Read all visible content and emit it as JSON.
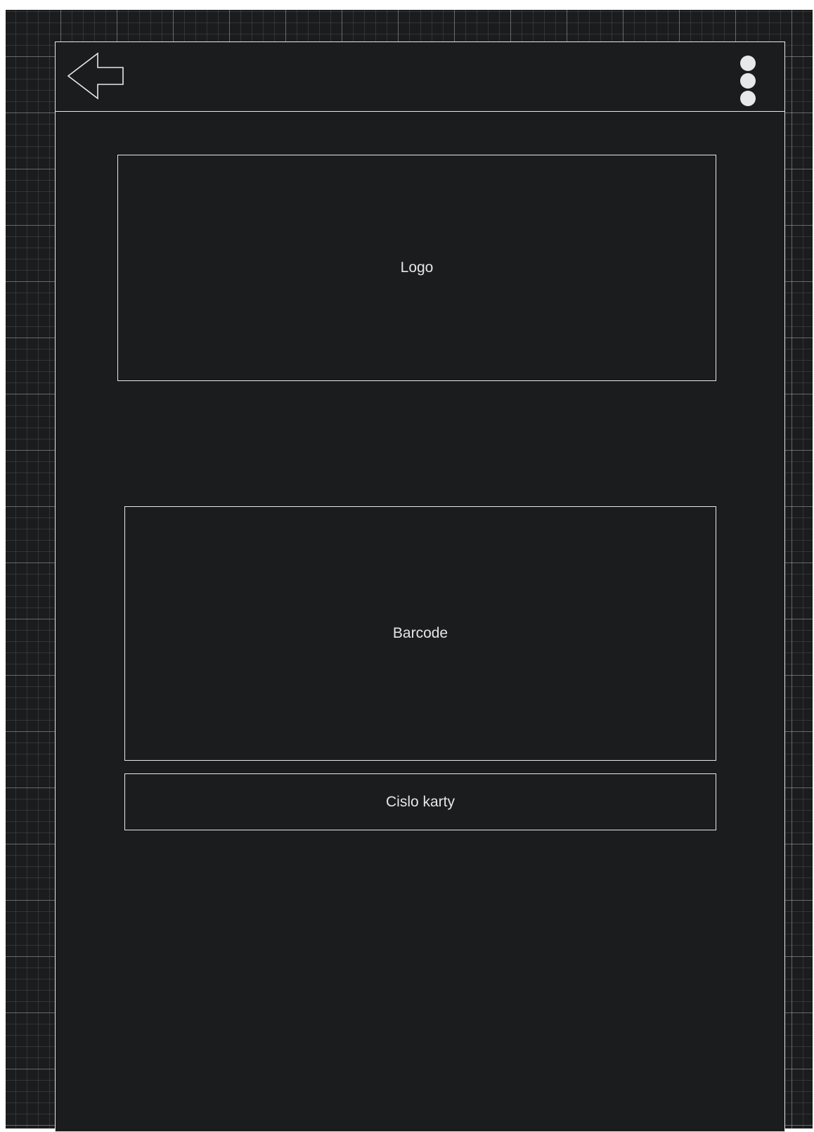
{
  "toolbar": {
    "back_icon": "back-arrow-icon",
    "more_icon": "more-vertical-icon"
  },
  "content": {
    "logo_label": "Logo",
    "barcode_label": "Barcode",
    "card_number_label": "Cislo karty"
  },
  "colors": {
    "canvas_background": "#1b1c1e",
    "stroke": "#e8e8e8",
    "text": "#e6e6e6",
    "page_background": "#ffffff"
  }
}
